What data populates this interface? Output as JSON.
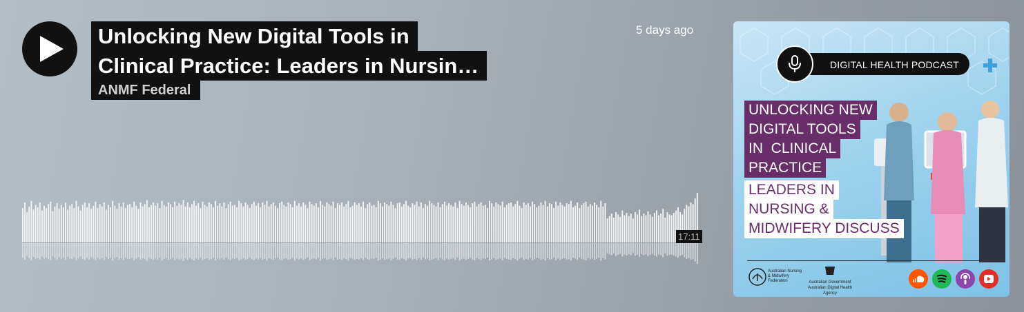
{
  "episode": {
    "title_line1": "Unlocking New Digital Tools in",
    "title_line2": "Clinical Practice: Leaders in Nursin…",
    "author": "ANMF Federal",
    "posted": "5 days ago",
    "duration": "17:11"
  },
  "artwork": {
    "badge": "DIGITAL HEALTH PODCAST",
    "purple_lines": [
      "UNLOCKING NEW",
      "DIGITAL TOOLS",
      "IN  CLINICAL",
      "PRACTICE"
    ],
    "white_lines": [
      "LEADERS IN",
      "NURSING &",
      "MIDWIFERY DISCUSS"
    ],
    "org1": "Australian Nursing & Midwifery Federation",
    "org2_line1": "Australian Government",
    "org2_line2": "Australian Digital Health Agency",
    "platform_icons": [
      "soundcloud-icon",
      "spotify-icon",
      "apple-podcasts-icon",
      "youtube-icon"
    ],
    "colors": {
      "purple": "#6a2d6b",
      "soundcloud": "#ff5500",
      "spotify": "#1db954",
      "apple": "#8e44ad",
      "youtube": "#e52d27"
    }
  },
  "waveform": {
    "played_fraction": 0,
    "bars": [
      0.43,
      0.5,
      0.38,
      0.45,
      0.52,
      0.41,
      0.47,
      0.44,
      0.5,
      0.4,
      0.46,
      0.43,
      0.48,
      0.51,
      0.39,
      0.45,
      0.49,
      0.42,
      0.47,
      0.44,
      0.5,
      0.41,
      0.46,
      0.48,
      0.43,
      0.52,
      0.45,
      0.4,
      0.47,
      0.5,
      0.44,
      0.49,
      0.42,
      0.46,
      0.51,
      0.43,
      0.48,
      0.45,
      0.5,
      0.41,
      0.47,
      0.44,
      0.52,
      0.46,
      0.42,
      0.49,
      0.45,
      0.5,
      0.43,
      0.47,
      0.48,
      0.44,
      0.51,
      0.46,
      0.42,
      0.5,
      0.45,
      0.48,
      0.53,
      0.44,
      0.47,
      0.5,
      0.46,
      0.49,
      0.43,
      0.52,
      0.47,
      0.45,
      0.5,
      0.48,
      0.44,
      0.51,
      0.46,
      0.49,
      0.47,
      0.53,
      0.45,
      0.5,
      0.44,
      0.48,
      0.52,
      0.46,
      0.49,
      0.43,
      0.51,
      0.47,
      0.45,
      0.5,
      0.48,
      0.44,
      0.52,
      0.46,
      0.49,
      0.45,
      0.5,
      0.43,
      0.48,
      0.51,
      0.46,
      0.47,
      0.44,
      0.52,
      0.49,
      0.45,
      0.5,
      0.47,
      0.43,
      0.48,
      0.51,
      0.46,
      0.49,
      0.44,
      0.5,
      0.47,
      0.52,
      0.45,
      0.48,
      0.5,
      0.46,
      0.43,
      0.49,
      0.51,
      0.47,
      0.45,
      0.5,
      0.48,
      0.44,
      0.52,
      0.46,
      0.49,
      0.45,
      0.5,
      0.47,
      0.43,
      0.51,
      0.48,
      0.46,
      0.49,
      0.44,
      0.52,
      0.47,
      0.45,
      0.5,
      0.48,
      0.46,
      0.51,
      0.43,
      0.49,
      0.47,
      0.5,
      0.45,
      0.48,
      0.52,
      0.44,
      0.46,
      0.5,
      0.47,
      0.49,
      0.45,
      0.51,
      0.43,
      0.48,
      0.5,
      0.46,
      0.47,
      0.44,
      0.52,
      0.49,
      0.45,
      0.5,
      0.48,
      0.46,
      0.51,
      0.47,
      0.43,
      0.49,
      0.5,
      0.45,
      0.48,
      0.52,
      0.46,
      0.44,
      0.49,
      0.47,
      0.51,
      0.45,
      0.5,
      0.43,
      0.48,
      0.46,
      0.52,
      0.49,
      0.47,
      0.45,
      0.5,
      0.44,
      0.48,
      0.51,
      0.46,
      0.49,
      0.47,
      0.45,
      0.5,
      0.43,
      0.52,
      0.48,
      0.46,
      0.5,
      0.47,
      0.44,
      0.49,
      0.51,
      0.45,
      0.48,
      0.5,
      0.46,
      0.47,
      0.43,
      0.52,
      0.49,
      0.45,
      0.5,
      0.48,
      0.46,
      0.51,
      0.44,
      0.47,
      0.49,
      0.5,
      0.45,
      0.48,
      0.52,
      0.46,
      0.43,
      0.5,
      0.47,
      0.49,
      0.45,
      0.51,
      0.48,
      0.44,
      0.46,
      0.5,
      0.47,
      0.52,
      0.45,
      0.49,
      0.48,
      0.43,
      0.51,
      0.46,
      0.5,
      0.47,
      0.45,
      0.49,
      0.48,
      0.52,
      0.44,
      0.46,
      0.5,
      0.43,
      0.47,
      0.49,
      0.51,
      0.45,
      0.48,
      0.46,
      0.5,
      0.47,
      0.44,
      0.52,
      0.45,
      0.49,
      0.3,
      0.33,
      0.36,
      0.31,
      0.38,
      0.35,
      0.32,
      0.4,
      0.34,
      0.37,
      0.33,
      0.36,
      0.3,
      0.38,
      0.35,
      0.41,
      0.33,
      0.36,
      0.34,
      0.39,
      0.35,
      0.32,
      0.37,
      0.4,
      0.34,
      0.36,
      0.42,
      0.31,
      0.38,
      0.35,
      0.34,
      0.37,
      0.4,
      0.44,
      0.38,
      0.35,
      0.42,
      0.47,
      0.45,
      0.5,
      0.48,
      0.55,
      0.62
    ]
  }
}
